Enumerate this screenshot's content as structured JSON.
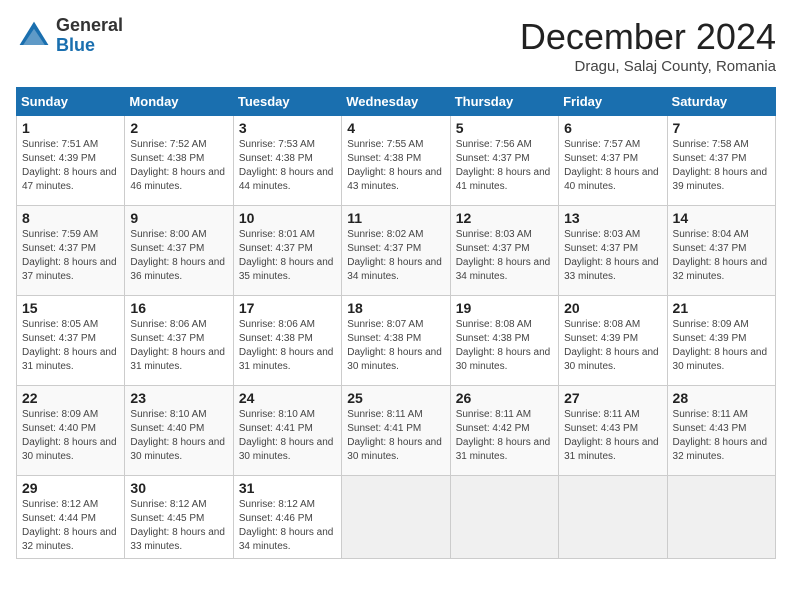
{
  "logo": {
    "general": "General",
    "blue": "Blue"
  },
  "header": {
    "month": "December 2024",
    "location": "Dragu, Salaj County, Romania"
  },
  "days_of_week": [
    "Sunday",
    "Monday",
    "Tuesday",
    "Wednesday",
    "Thursday",
    "Friday",
    "Saturday"
  ],
  "weeks": [
    [
      {
        "day": "1",
        "sunrise": "Sunrise: 7:51 AM",
        "sunset": "Sunset: 4:39 PM",
        "daylight": "Daylight: 8 hours and 47 minutes."
      },
      {
        "day": "2",
        "sunrise": "Sunrise: 7:52 AM",
        "sunset": "Sunset: 4:38 PM",
        "daylight": "Daylight: 8 hours and 46 minutes."
      },
      {
        "day": "3",
        "sunrise": "Sunrise: 7:53 AM",
        "sunset": "Sunset: 4:38 PM",
        "daylight": "Daylight: 8 hours and 44 minutes."
      },
      {
        "day": "4",
        "sunrise": "Sunrise: 7:55 AM",
        "sunset": "Sunset: 4:38 PM",
        "daylight": "Daylight: 8 hours and 43 minutes."
      },
      {
        "day": "5",
        "sunrise": "Sunrise: 7:56 AM",
        "sunset": "Sunset: 4:37 PM",
        "daylight": "Daylight: 8 hours and 41 minutes."
      },
      {
        "day": "6",
        "sunrise": "Sunrise: 7:57 AM",
        "sunset": "Sunset: 4:37 PM",
        "daylight": "Daylight: 8 hours and 40 minutes."
      },
      {
        "day": "7",
        "sunrise": "Sunrise: 7:58 AM",
        "sunset": "Sunset: 4:37 PM",
        "daylight": "Daylight: 8 hours and 39 minutes."
      }
    ],
    [
      {
        "day": "8",
        "sunrise": "Sunrise: 7:59 AM",
        "sunset": "Sunset: 4:37 PM",
        "daylight": "Daylight: 8 hours and 37 minutes."
      },
      {
        "day": "9",
        "sunrise": "Sunrise: 8:00 AM",
        "sunset": "Sunset: 4:37 PM",
        "daylight": "Daylight: 8 hours and 36 minutes."
      },
      {
        "day": "10",
        "sunrise": "Sunrise: 8:01 AM",
        "sunset": "Sunset: 4:37 PM",
        "daylight": "Daylight: 8 hours and 35 minutes."
      },
      {
        "day": "11",
        "sunrise": "Sunrise: 8:02 AM",
        "sunset": "Sunset: 4:37 PM",
        "daylight": "Daylight: 8 hours and 34 minutes."
      },
      {
        "day": "12",
        "sunrise": "Sunrise: 8:03 AM",
        "sunset": "Sunset: 4:37 PM",
        "daylight": "Daylight: 8 hours and 34 minutes."
      },
      {
        "day": "13",
        "sunrise": "Sunrise: 8:03 AM",
        "sunset": "Sunset: 4:37 PM",
        "daylight": "Daylight: 8 hours and 33 minutes."
      },
      {
        "day": "14",
        "sunrise": "Sunrise: 8:04 AM",
        "sunset": "Sunset: 4:37 PM",
        "daylight": "Daylight: 8 hours and 32 minutes."
      }
    ],
    [
      {
        "day": "15",
        "sunrise": "Sunrise: 8:05 AM",
        "sunset": "Sunset: 4:37 PM",
        "daylight": "Daylight: 8 hours and 31 minutes."
      },
      {
        "day": "16",
        "sunrise": "Sunrise: 8:06 AM",
        "sunset": "Sunset: 4:37 PM",
        "daylight": "Daylight: 8 hours and 31 minutes."
      },
      {
        "day": "17",
        "sunrise": "Sunrise: 8:06 AM",
        "sunset": "Sunset: 4:38 PM",
        "daylight": "Daylight: 8 hours and 31 minutes."
      },
      {
        "day": "18",
        "sunrise": "Sunrise: 8:07 AM",
        "sunset": "Sunset: 4:38 PM",
        "daylight": "Daylight: 8 hours and 30 minutes."
      },
      {
        "day": "19",
        "sunrise": "Sunrise: 8:08 AM",
        "sunset": "Sunset: 4:38 PM",
        "daylight": "Daylight: 8 hours and 30 minutes."
      },
      {
        "day": "20",
        "sunrise": "Sunrise: 8:08 AM",
        "sunset": "Sunset: 4:39 PM",
        "daylight": "Daylight: 8 hours and 30 minutes."
      },
      {
        "day": "21",
        "sunrise": "Sunrise: 8:09 AM",
        "sunset": "Sunset: 4:39 PM",
        "daylight": "Daylight: 8 hours and 30 minutes."
      }
    ],
    [
      {
        "day": "22",
        "sunrise": "Sunrise: 8:09 AM",
        "sunset": "Sunset: 4:40 PM",
        "daylight": "Daylight: 8 hours and 30 minutes."
      },
      {
        "day": "23",
        "sunrise": "Sunrise: 8:10 AM",
        "sunset": "Sunset: 4:40 PM",
        "daylight": "Daylight: 8 hours and 30 minutes."
      },
      {
        "day": "24",
        "sunrise": "Sunrise: 8:10 AM",
        "sunset": "Sunset: 4:41 PM",
        "daylight": "Daylight: 8 hours and 30 minutes."
      },
      {
        "day": "25",
        "sunrise": "Sunrise: 8:11 AM",
        "sunset": "Sunset: 4:41 PM",
        "daylight": "Daylight: 8 hours and 30 minutes."
      },
      {
        "day": "26",
        "sunrise": "Sunrise: 8:11 AM",
        "sunset": "Sunset: 4:42 PM",
        "daylight": "Daylight: 8 hours and 31 minutes."
      },
      {
        "day": "27",
        "sunrise": "Sunrise: 8:11 AM",
        "sunset": "Sunset: 4:43 PM",
        "daylight": "Daylight: 8 hours and 31 minutes."
      },
      {
        "day": "28",
        "sunrise": "Sunrise: 8:11 AM",
        "sunset": "Sunset: 4:43 PM",
        "daylight": "Daylight: 8 hours and 32 minutes."
      }
    ],
    [
      {
        "day": "29",
        "sunrise": "Sunrise: 8:12 AM",
        "sunset": "Sunset: 4:44 PM",
        "daylight": "Daylight: 8 hours and 32 minutes."
      },
      {
        "day": "30",
        "sunrise": "Sunrise: 8:12 AM",
        "sunset": "Sunset: 4:45 PM",
        "daylight": "Daylight: 8 hours and 33 minutes."
      },
      {
        "day": "31",
        "sunrise": "Sunrise: 8:12 AM",
        "sunset": "Sunset: 4:46 PM",
        "daylight": "Daylight: 8 hours and 34 minutes."
      },
      null,
      null,
      null,
      null
    ]
  ]
}
